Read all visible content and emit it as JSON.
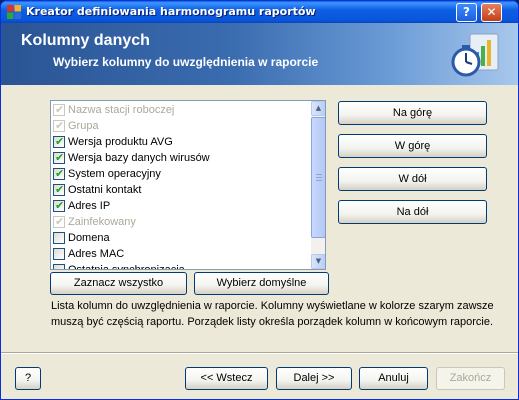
{
  "window": {
    "title": "Kreator definiowania harmonogramu raportów",
    "help_glyph": "?",
    "close_glyph": "✕"
  },
  "header": {
    "title": "Kolumny danych",
    "subtitle": "Wybierz kolumny do uwzględnienia w raporcie",
    "logo_icon": "report-schedule-clock-chart-icon"
  },
  "columns_list": {
    "items": [
      {
        "label": "Nazwa stacji roboczej",
        "checked": true,
        "disabled": true
      },
      {
        "label": "Grupa",
        "checked": true,
        "disabled": true
      },
      {
        "label": "Wersja produktu AVG",
        "checked": true,
        "disabled": false
      },
      {
        "label": "Wersja bazy danych wirusów",
        "checked": true,
        "disabled": false
      },
      {
        "label": "System operacyjny",
        "checked": true,
        "disabled": false
      },
      {
        "label": "Ostatni kontakt",
        "checked": true,
        "disabled": false
      },
      {
        "label": "Adres IP",
        "checked": true,
        "disabled": false
      },
      {
        "label": "Zainfekowany",
        "checked": true,
        "disabled": true
      },
      {
        "label": "Domena",
        "checked": false,
        "disabled": false
      },
      {
        "label": "Adres MAC",
        "checked": false,
        "disabled": false
      },
      {
        "label": "Ostatnia synchronizacja",
        "checked": false,
        "disabled": false
      }
    ]
  },
  "order_buttons": {
    "top": "Na górę",
    "up": "W górę",
    "down": "W dół",
    "bottom": "Na dół"
  },
  "selection_buttons": {
    "select_all": "Zaznacz wszystko",
    "select_default": "Wybierz domyślne"
  },
  "description": "Lista kolumn do uwzględnienia w raporcie. Kolumny wyświetlane w kolorze szarym zawsze muszą być częścią raportu. Porządek listy określa porządek kolumn w końcowym raporcie.",
  "footer": {
    "help": "?",
    "back": "<< Wstecz",
    "next": "Dalej >>",
    "cancel": "Anuluj",
    "finish": "Zakończ"
  }
}
